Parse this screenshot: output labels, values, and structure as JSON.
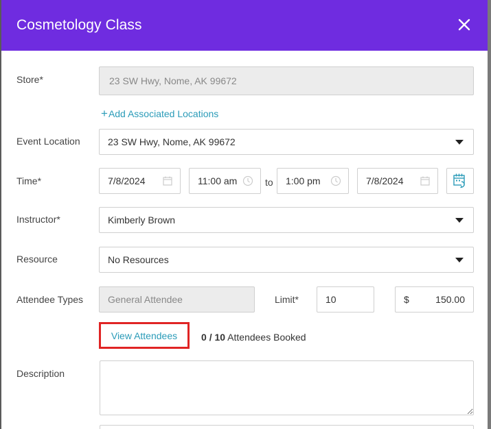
{
  "modal": {
    "title": "Cosmetology Class"
  },
  "form": {
    "store": {
      "label": "Store*",
      "value": "23 SW Hwy, Nome, AK 99672"
    },
    "add_locations": {
      "label": "Add Associated Locations"
    },
    "event_location": {
      "label": "Event Location",
      "value": "23 SW Hwy, Nome, AK 99672"
    },
    "time": {
      "label": "Time*",
      "start_date": "7/8/2024",
      "start_time": "11:00 am",
      "to": "to",
      "end_time": "1:00 pm",
      "end_date": "7/8/2024"
    },
    "instructor": {
      "label": "Instructor*",
      "value": "Kimberly Brown"
    },
    "resource": {
      "label": "Resource",
      "value": "No Resources"
    },
    "attendee_types": {
      "label": "Attendee Types",
      "value": "General Attendee",
      "limit_label": "Limit*",
      "limit_value": "10",
      "currency": "$",
      "price": "150.00"
    },
    "attendees": {
      "view_label": "View Attendees",
      "booked_count": "0",
      "separator": "/",
      "booked_limit": "10",
      "booked_suffix": "Attendees Booked"
    },
    "description": {
      "label": "Description",
      "value": ""
    }
  },
  "colors": {
    "header": "#6f2ce0",
    "link": "#2a9bb8",
    "highlight": "#e02424"
  }
}
